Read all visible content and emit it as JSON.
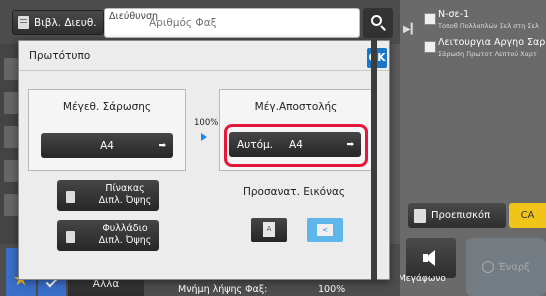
{
  "topbar": {
    "address_book_label": "Βιβλ. Διευθ.",
    "destination_label": "Διεύθυνση",
    "fax_number_placeholder": "Αριθμός Φαξ"
  },
  "job_list": [
    {
      "title": "N-σε-1",
      "subtitle": "Τοποθ Πολλαπλών Σελ στη Σελ"
    },
    {
      "title": "Λειτουργια Αργηο Σαρωσης",
      "subtitle": "Σάρωση Πρωτοτ Λεπτού Χαρτ"
    }
  ],
  "right_panel": {
    "preview_label": "Προεπισκόπ",
    "ca_label": "CA",
    "speaker_label": "Μεγάφωνο",
    "send_label": "Έναρξ"
  },
  "bottombar": {
    "more_label": "Άλλα",
    "memory_label": "Μνήμη λήψης Φαξ:",
    "memory_value": "100%"
  },
  "dialog": {
    "title": "Πρωτότυπο",
    "ok_label": "OK",
    "scan_size": {
      "title": "Μέγεθ. Σάρωσης",
      "value": "A4"
    },
    "ratio": "100%",
    "send_size": {
      "title": "Μέγ.Αποστολής",
      "mode": "Αυτόμ.",
      "value": "A4"
    },
    "duplex_book": {
      "line1": "Πίνακας",
      "line2": "Διπλ. Όψης"
    },
    "duplex_tablet": {
      "line1": "Φυλλάδιο",
      "line2": "Διπλ. Όψης"
    },
    "orientation": {
      "label": "Προσανατ. Εικόνας",
      "portrait_glyph": "A",
      "landscape_glyph": "A",
      "selected": "landscape"
    }
  },
  "colors": {
    "accent": "#1976c9",
    "highlight": "#e3183a",
    "selected_orientation": "#5fb6ea",
    "ca_button": "#f0c419"
  }
}
